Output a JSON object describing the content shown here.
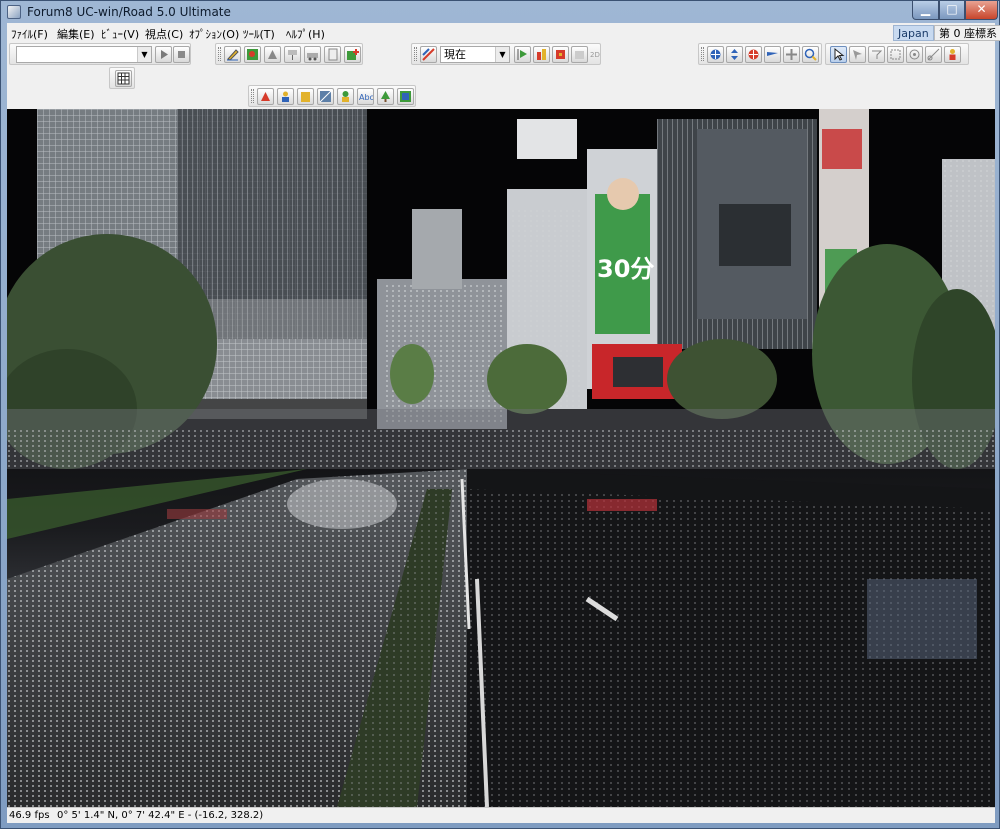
{
  "window": {
    "title": "Forum8 UC-win/Road 5.0 Ultimate",
    "minimize_glyph": "▁",
    "maximize_glyph": "□",
    "close_glyph": "✕"
  },
  "menu": {
    "items": [
      {
        "label": "ﾌｧｲﾙ(F)"
      },
      {
        "label": "編集(E)"
      },
      {
        "label": "ﾋﾞｭｰ(V)"
      },
      {
        "label": "視点(C)"
      },
      {
        "label": "ｵﾌﾟｼｮﾝ(O)"
      },
      {
        "label": "ﾂｰﾙ(T)"
      },
      {
        "label": "ﾍﾙﾌﾟ(H)"
      }
    ],
    "region_tag": "Japan",
    "coord_system": "第 0 座標系"
  },
  "toolbar": {
    "time_combo_value": "現在",
    "accent_colors": {
      "blue": "#2f63b8",
      "red": "#d63b2a",
      "green": "#3d9a3a",
      "yellow": "#e2b22c"
    }
  },
  "icons": {
    "play": "play-icon",
    "stop": "stop-icon",
    "grid": "grid-icon",
    "cursor": "cursor-icon"
  },
  "viewport": {
    "ad_billboard_text": "30分"
  },
  "status": {
    "fps": "46.9 fps",
    "coordinates": "0°   5' 1.4\" N, 0°   7' 42.4\" E  -  (-16.2, 328.2)"
  }
}
